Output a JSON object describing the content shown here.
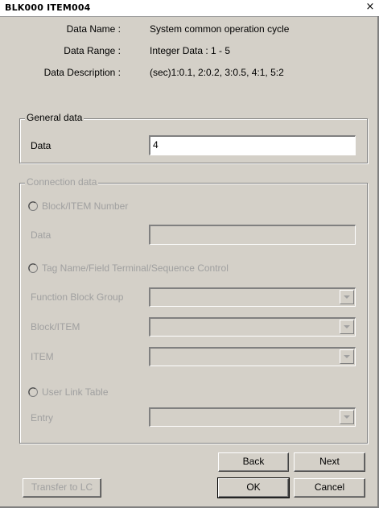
{
  "window": {
    "title": "BLK000 ITEM004",
    "close_glyph": "×"
  },
  "info": {
    "name_label": "Data Name :",
    "name_value": "System common operation cycle",
    "range_label": "Data Range :",
    "range_value": "Integer Data : 1 - 5",
    "desc_label": "Data Description :",
    "desc_value": "(sec)1:0.1, 2:0.2, 3:0.5, 4:1, 5:2"
  },
  "general": {
    "legend": "General data",
    "data_label": "Data",
    "data_value": "4"
  },
  "connection": {
    "legend": "Connection data",
    "block_item_radio": "Block/ITEM Number",
    "data_label": "Data",
    "data_value": "",
    "tag_radio": "Tag Name/Field Terminal/Sequence Control",
    "fbg_label": "Function Block Group",
    "fbg_value": "",
    "blockitem_label": "Block/ITEM",
    "blockitem_value": "",
    "item_label": "ITEM",
    "item_value": "",
    "userlink_radio": "User Link Table",
    "entry_label": "Entry",
    "entry_value": ""
  },
  "buttons": {
    "back": "Back",
    "next": "Next",
    "transfer": "Transfer to LC",
    "ok": "OK",
    "cancel": "Cancel"
  }
}
